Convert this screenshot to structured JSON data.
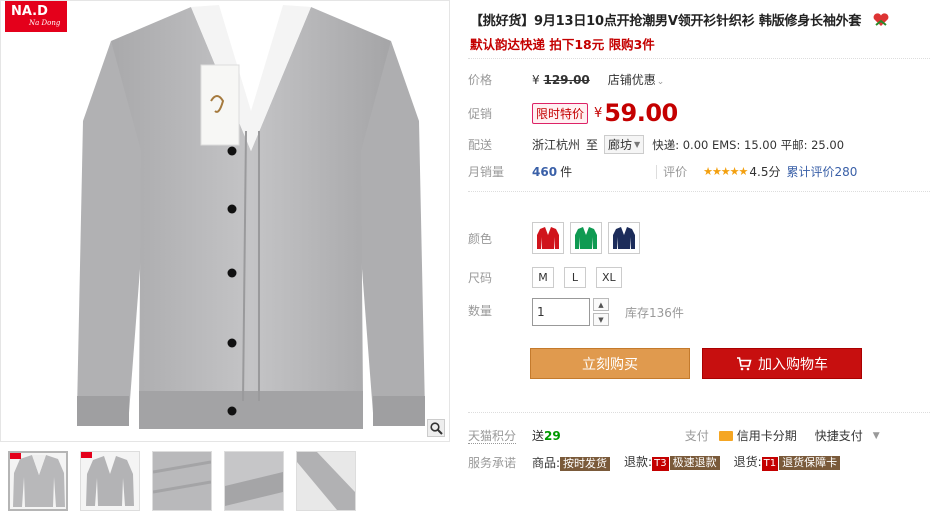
{
  "brand": {
    "logo_text": "NA.D",
    "logo_sub": "Na Dong"
  },
  "product": {
    "title": "【挑好货】9月13日10点开抢潮男V领开衫针织衫 韩版修身长袖外套",
    "subtitle": "默认韵达快递 拍下18元 限购3件"
  },
  "price": {
    "label": "价格",
    "currency": "¥",
    "original": "129.00",
    "store_discount": "店铺优惠"
  },
  "promo": {
    "label": "促销",
    "tag": "限时特价",
    "currency": "¥",
    "value": "59.00"
  },
  "shipping": {
    "label": "配送",
    "from": "浙江杭州",
    "to_label": "至",
    "dest": "廊坊",
    "fees": "快递: 0.00 EMS: 15.00 平邮: 25.00"
  },
  "sales": {
    "label": "月销量",
    "value": "460",
    "unit": "件",
    "rating_label": "评价",
    "stars": "★★★★★",
    "rating": "4.5分",
    "reviews": "累计评价280"
  },
  "options": {
    "color_label": "颜色",
    "colors": [
      {
        "name": "red",
        "hex": "#d0141c"
      },
      {
        "name": "green",
        "hex": "#0f9a52"
      },
      {
        "name": "navy",
        "hex": "#1c2c5a"
      }
    ],
    "size_label": "尺码",
    "sizes": [
      "M",
      "L",
      "XL"
    ],
    "qty_label": "数量",
    "qty_value": "1",
    "stock": "库存136件"
  },
  "actions": {
    "buy_now": "立刻购买",
    "add_cart": "加入购物车"
  },
  "services": {
    "points_label": "天猫积分",
    "points_value_prefix": "送",
    "points_value": "29",
    "pay_label": "支付",
    "pay_credit": "信用卡分期",
    "pay_quick": "快捷支付",
    "promise_label": "服务承诺",
    "goods_label": "商品:",
    "goods_badge": "按时发货",
    "refund_label": "退款:",
    "refund_tag": "T3",
    "refund_badge": "极速退款",
    "return_label": "退货:",
    "return_tag": "T1",
    "return_badge": "退货保障卡"
  },
  "colors": {
    "accent": "#c40000",
    "link": "#3a60a8",
    "buy": "#e09a4e",
    "cart": "#c70f0f"
  }
}
